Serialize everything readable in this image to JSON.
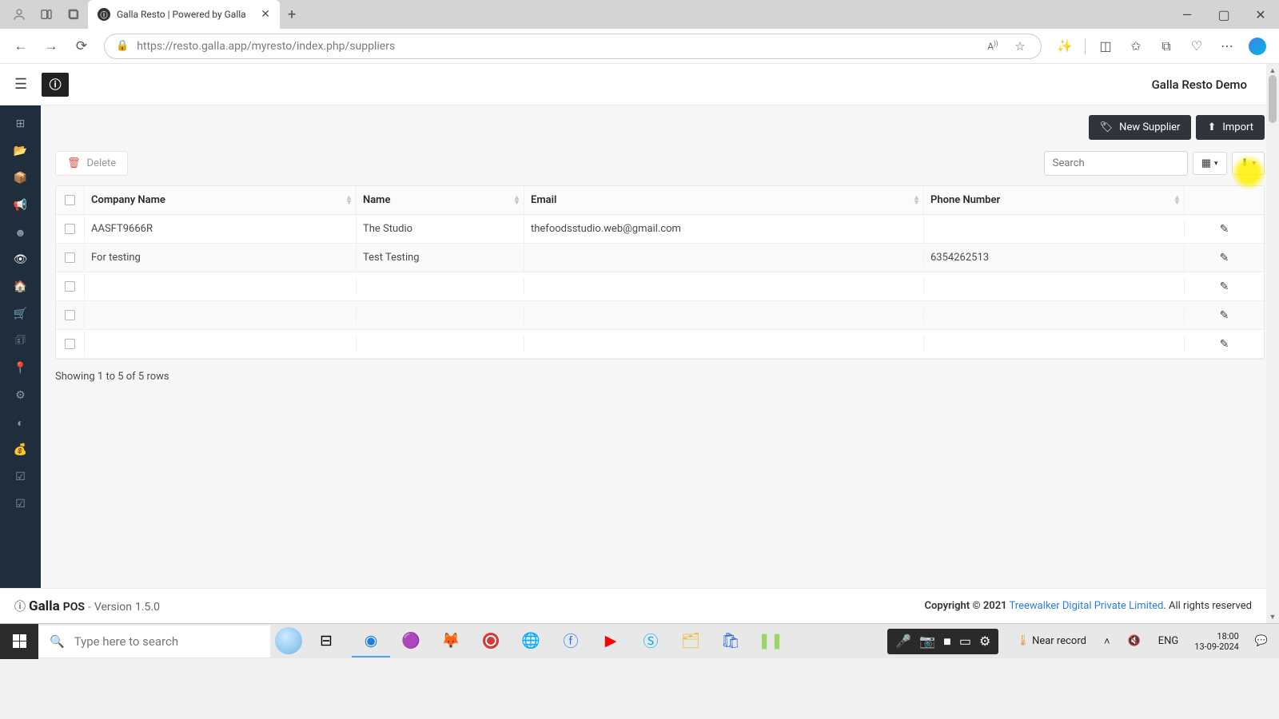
{
  "browser": {
    "tab_title": "Galla Resto | Powered by Galla",
    "url": "https://resto.galla.app/myresto/index.php/suppliers"
  },
  "header": {
    "demo_label": "Galla Resto Demo"
  },
  "actions": {
    "new_supplier": "New Supplier",
    "import": "Import",
    "delete": "Delete"
  },
  "search": {
    "placeholder": "Search"
  },
  "table": {
    "columns": {
      "company": "Company Name",
      "name": "Name",
      "email": "Email",
      "phone": "Phone Number"
    },
    "rows": [
      {
        "company": "AASFT9666R",
        "name": "The Studio",
        "email": "thefoodsstudio.web@gmail.com",
        "phone": ""
      },
      {
        "company": "For testing",
        "name": "Test Testing",
        "email": "",
        "phone": "6354262513"
      },
      {
        "company": "",
        "name": "",
        "email": "",
        "phone": ""
      },
      {
        "company": "",
        "name": "",
        "email": "",
        "phone": ""
      },
      {
        "company": "",
        "name": "",
        "email": "",
        "phone": ""
      }
    ],
    "results_text": "Showing 1 to 5 of 5 rows"
  },
  "footer": {
    "brand": "Galla",
    "pos": "POS",
    "version_label": "Version",
    "version": "1.5.0",
    "copyright": "Copyright © 2021",
    "company": "Treewalker Digital Private Limited",
    "rights": ". All rights reserved"
  },
  "taskbar": {
    "search_placeholder": "Type here to search",
    "weather": "Near record",
    "lang": "ENG",
    "time": "18:00",
    "date": "13-09-2024"
  }
}
